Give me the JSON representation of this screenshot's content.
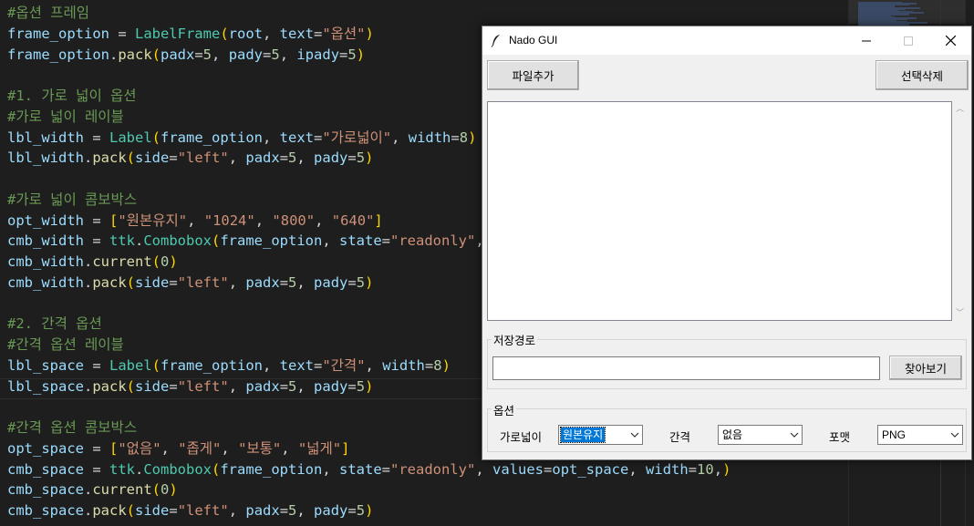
{
  "editor": {
    "lines": [
      [
        {
          "t": "#옵션 프레임",
          "c": "t-c"
        }
      ],
      [
        {
          "t": "frame_option",
          "c": "t-v"
        },
        {
          "t": " = ",
          "c": "t-p"
        },
        {
          "t": "LabelFrame",
          "c": "t-cl"
        },
        {
          "t": "(",
          "c": "t-b1"
        },
        {
          "t": "root",
          "c": "t-v"
        },
        {
          "t": ", ",
          "c": "t-p"
        },
        {
          "t": "text",
          "c": "t-v"
        },
        {
          "t": "=",
          "c": "t-p"
        },
        {
          "t": "\"옵션\"",
          "c": "t-s"
        },
        {
          "t": ")",
          "c": "t-b1"
        }
      ],
      [
        {
          "t": "frame_option",
          "c": "t-v"
        },
        {
          "t": ".",
          "c": "t-p"
        },
        {
          "t": "pack",
          "c": "t-f"
        },
        {
          "t": "(",
          "c": "t-b1"
        },
        {
          "t": "padx",
          "c": "t-v"
        },
        {
          "t": "=",
          "c": "t-p"
        },
        {
          "t": "5",
          "c": "t-n"
        },
        {
          "t": ", ",
          "c": "t-p"
        },
        {
          "t": "pady",
          "c": "t-v"
        },
        {
          "t": "=",
          "c": "t-p"
        },
        {
          "t": "5",
          "c": "t-n"
        },
        {
          "t": ", ",
          "c": "t-p"
        },
        {
          "t": "ipady",
          "c": "t-v"
        },
        {
          "t": "=",
          "c": "t-p"
        },
        {
          "t": "5",
          "c": "t-n"
        },
        {
          "t": ")",
          "c": "t-b1"
        }
      ],
      [],
      [
        {
          "t": "#1. 가로 넓이 옵션",
          "c": "t-c"
        }
      ],
      [
        {
          "t": "#가로 넓이 레이블",
          "c": "t-c"
        }
      ],
      [
        {
          "t": "lbl_width",
          "c": "t-v"
        },
        {
          "t": " = ",
          "c": "t-p"
        },
        {
          "t": "Label",
          "c": "t-cl"
        },
        {
          "t": "(",
          "c": "t-b1"
        },
        {
          "t": "frame_option",
          "c": "t-v"
        },
        {
          "t": ", ",
          "c": "t-p"
        },
        {
          "t": "text",
          "c": "t-v"
        },
        {
          "t": "=",
          "c": "t-p"
        },
        {
          "t": "\"가로넓이\"",
          "c": "t-s"
        },
        {
          "t": ", ",
          "c": "t-p"
        },
        {
          "t": "width",
          "c": "t-v"
        },
        {
          "t": "=",
          "c": "t-p"
        },
        {
          "t": "8",
          "c": "t-n"
        },
        {
          "t": ")",
          "c": "t-b1"
        }
      ],
      [
        {
          "t": "lbl_width",
          "c": "t-v"
        },
        {
          "t": ".",
          "c": "t-p"
        },
        {
          "t": "pack",
          "c": "t-f"
        },
        {
          "t": "(",
          "c": "t-b1"
        },
        {
          "t": "side",
          "c": "t-v"
        },
        {
          "t": "=",
          "c": "t-p"
        },
        {
          "t": "\"left\"",
          "c": "t-s"
        },
        {
          "t": ", ",
          "c": "t-p"
        },
        {
          "t": "padx",
          "c": "t-v"
        },
        {
          "t": "=",
          "c": "t-p"
        },
        {
          "t": "5",
          "c": "t-n"
        },
        {
          "t": ", ",
          "c": "t-p"
        },
        {
          "t": "pady",
          "c": "t-v"
        },
        {
          "t": "=",
          "c": "t-p"
        },
        {
          "t": "5",
          "c": "t-n"
        },
        {
          "t": ")",
          "c": "t-b1"
        }
      ],
      [],
      [
        {
          "t": "#가로 넓이 콤보박스",
          "c": "t-c"
        }
      ],
      [
        {
          "t": "opt_width",
          "c": "t-v"
        },
        {
          "t": " = ",
          "c": "t-p"
        },
        {
          "t": "[",
          "c": "t-b1"
        },
        {
          "t": "\"원본유지\"",
          "c": "t-s"
        },
        {
          "t": ", ",
          "c": "t-p"
        },
        {
          "t": "\"1024\"",
          "c": "t-s"
        },
        {
          "t": ", ",
          "c": "t-p"
        },
        {
          "t": "\"800\"",
          "c": "t-s"
        },
        {
          "t": ", ",
          "c": "t-p"
        },
        {
          "t": "\"640\"",
          "c": "t-s"
        },
        {
          "t": "]",
          "c": "t-b1"
        }
      ],
      [
        {
          "t": "cmb_width",
          "c": "t-v"
        },
        {
          "t": " = ",
          "c": "t-p"
        },
        {
          "t": "ttk",
          "c": "t-cl"
        },
        {
          "t": ".",
          "c": "t-p"
        },
        {
          "t": "Combobox",
          "c": "t-cl"
        },
        {
          "t": "(",
          "c": "t-b1"
        },
        {
          "t": "frame_option",
          "c": "t-v"
        },
        {
          "t": ", ",
          "c": "t-p"
        },
        {
          "t": "state",
          "c": "t-v"
        },
        {
          "t": "=",
          "c": "t-p"
        },
        {
          "t": "\"readonly\"",
          "c": "t-s"
        },
        {
          "t": ",",
          "c": "t-p"
        }
      ],
      [
        {
          "t": "cmb_width",
          "c": "t-v"
        },
        {
          "t": ".",
          "c": "t-p"
        },
        {
          "t": "current",
          "c": "t-f"
        },
        {
          "t": "(",
          "c": "t-b1"
        },
        {
          "t": "0",
          "c": "t-n"
        },
        {
          "t": ")",
          "c": "t-b1"
        }
      ],
      [
        {
          "t": "cmb_width",
          "c": "t-v"
        },
        {
          "t": ".",
          "c": "t-p"
        },
        {
          "t": "pack",
          "c": "t-f"
        },
        {
          "t": "(",
          "c": "t-b1"
        },
        {
          "t": "side",
          "c": "t-v"
        },
        {
          "t": "=",
          "c": "t-p"
        },
        {
          "t": "\"left\"",
          "c": "t-s"
        },
        {
          "t": ", ",
          "c": "t-p"
        },
        {
          "t": "padx",
          "c": "t-v"
        },
        {
          "t": "=",
          "c": "t-p"
        },
        {
          "t": "5",
          "c": "t-n"
        },
        {
          "t": ", ",
          "c": "t-p"
        },
        {
          "t": "pady",
          "c": "t-v"
        },
        {
          "t": "=",
          "c": "t-p"
        },
        {
          "t": "5",
          "c": "t-n"
        },
        {
          "t": ")",
          "c": "t-b1"
        }
      ],
      [],
      [
        {
          "t": "#2. 간격 옵션",
          "c": "t-c"
        }
      ],
      [
        {
          "t": "#간격 옵션 레이블",
          "c": "t-c"
        }
      ],
      [
        {
          "t": "lbl_space",
          "c": "t-v"
        },
        {
          "t": " = ",
          "c": "t-p"
        },
        {
          "t": "Label",
          "c": "t-cl"
        },
        {
          "t": "(",
          "c": "t-b1"
        },
        {
          "t": "frame_option",
          "c": "t-v"
        },
        {
          "t": ", ",
          "c": "t-p"
        },
        {
          "t": "text",
          "c": "t-v"
        },
        {
          "t": "=",
          "c": "t-p"
        },
        {
          "t": "\"간격\"",
          "c": "t-s"
        },
        {
          "t": ", ",
          "c": "t-p"
        },
        {
          "t": "width",
          "c": "t-v"
        },
        {
          "t": "=",
          "c": "t-p"
        },
        {
          "t": "8",
          "c": "t-n"
        },
        {
          "t": ")",
          "c": "t-b1"
        }
      ],
      [
        {
          "t": "lbl_space",
          "c": "t-v"
        },
        {
          "t": ".",
          "c": "t-p"
        },
        {
          "t": "pack",
          "c": "t-f"
        },
        {
          "t": "(",
          "c": "t-b1"
        },
        {
          "t": "side",
          "c": "t-v"
        },
        {
          "t": "=",
          "c": "t-p"
        },
        {
          "t": "\"left\"",
          "c": "t-s"
        },
        {
          "t": ", ",
          "c": "t-p"
        },
        {
          "t": "padx",
          "c": "t-v"
        },
        {
          "t": "=",
          "c": "t-p"
        },
        {
          "t": "5",
          "c": "t-n"
        },
        {
          "t": ", ",
          "c": "t-p"
        },
        {
          "t": "pady",
          "c": "t-v"
        },
        {
          "t": "=",
          "c": "t-p"
        },
        {
          "t": "5",
          "c": "t-n"
        },
        {
          "t": ")",
          "c": "t-b1"
        }
      ],
      [],
      [
        {
          "t": "#간격 옵션 콤보박스",
          "c": "t-c"
        }
      ],
      [
        {
          "t": "opt_space",
          "c": "t-v"
        },
        {
          "t": " = ",
          "c": "t-p"
        },
        {
          "t": "[",
          "c": "t-b1"
        },
        {
          "t": "\"없음\"",
          "c": "t-s"
        },
        {
          "t": ", ",
          "c": "t-p"
        },
        {
          "t": "\"좁게\"",
          "c": "t-s"
        },
        {
          "t": ", ",
          "c": "t-p"
        },
        {
          "t": "\"보통\"",
          "c": "t-s"
        },
        {
          "t": ", ",
          "c": "t-p"
        },
        {
          "t": "\"넓게\"",
          "c": "t-s"
        },
        {
          "t": "]",
          "c": "t-b1"
        }
      ],
      [
        {
          "t": "cmb_space",
          "c": "t-v"
        },
        {
          "t": " = ",
          "c": "t-p"
        },
        {
          "t": "ttk",
          "c": "t-cl"
        },
        {
          "t": ".",
          "c": "t-p"
        },
        {
          "t": "Combobox",
          "c": "t-cl"
        },
        {
          "t": "(",
          "c": "t-b1"
        },
        {
          "t": "frame_option",
          "c": "t-v"
        },
        {
          "t": ", ",
          "c": "t-p"
        },
        {
          "t": "state",
          "c": "t-v"
        },
        {
          "t": "=",
          "c": "t-p"
        },
        {
          "t": "\"readonly\"",
          "c": "t-s"
        },
        {
          "t": ", ",
          "c": "t-p"
        },
        {
          "t": "values",
          "c": "t-v"
        },
        {
          "t": "=",
          "c": "t-p"
        },
        {
          "t": "opt_space",
          "c": "t-v"
        },
        {
          "t": ", ",
          "c": "t-p"
        },
        {
          "t": "width",
          "c": "t-v"
        },
        {
          "t": "=",
          "c": "t-p"
        },
        {
          "t": "10",
          "c": "t-n"
        },
        {
          "t": ",",
          "c": "t-p"
        },
        {
          "t": ")",
          "c": "t-b1"
        }
      ],
      [
        {
          "t": "cmb_space",
          "c": "t-v"
        },
        {
          "t": ".",
          "c": "t-p"
        },
        {
          "t": "current",
          "c": "t-f"
        },
        {
          "t": "(",
          "c": "t-b1"
        },
        {
          "t": "0",
          "c": "t-n"
        },
        {
          "t": ")",
          "c": "t-b1"
        }
      ],
      [
        {
          "t": "cmb_space",
          "c": "t-v"
        },
        {
          "t": ".",
          "c": "t-p"
        },
        {
          "t": "pack",
          "c": "t-f"
        },
        {
          "t": "(",
          "c": "t-b1"
        },
        {
          "t": "side",
          "c": "t-v"
        },
        {
          "t": "=",
          "c": "t-p"
        },
        {
          "t": "\"left\"",
          "c": "t-s"
        },
        {
          "t": ", ",
          "c": "t-p"
        },
        {
          "t": "padx",
          "c": "t-v"
        },
        {
          "t": "=",
          "c": "t-p"
        },
        {
          "t": "5",
          "c": "t-n"
        },
        {
          "t": ", ",
          "c": "t-p"
        },
        {
          "t": "pady",
          "c": "t-v"
        },
        {
          "t": "=",
          "c": "t-p"
        },
        {
          "t": "5",
          "c": "t-n"
        },
        {
          "t": ")",
          "c": "t-b1"
        }
      ]
    ]
  },
  "window": {
    "title": "Nado GUI",
    "icon": "feather-icon",
    "controls": [
      "minimize-icon",
      "maximize-icon",
      "close-icon"
    ]
  },
  "buttons": {
    "add_file": "파일추가",
    "delete_selected": "선택삭제",
    "browse": "찾아보기"
  },
  "save_path": {
    "frame_label": "저장경로",
    "value": ""
  },
  "options": {
    "frame_label": "옵션",
    "width_label": "가로넓이",
    "width_value": "원본유지",
    "space_label": "간격",
    "space_value": "없음",
    "format_label": "포맷",
    "format_value": "PNG"
  },
  "colors": {
    "editor_bg": "#1e1e1e",
    "selection_blue": "#0078d7"
  }
}
